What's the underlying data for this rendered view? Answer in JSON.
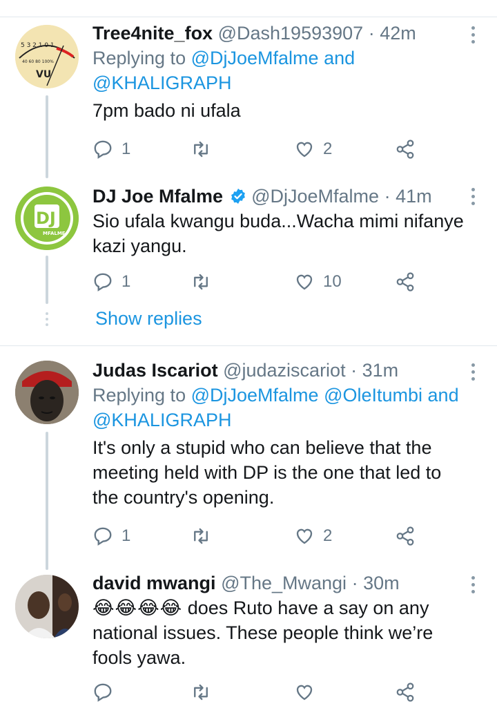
{
  "tweets": [
    {
      "name": "Tree4nite_fox",
      "handle": "@Dash19593907",
      "sep": "·",
      "time": "42m",
      "replying_prefix": "Replying to",
      "replying_mentions_line1": "@DjJoeMfalme",
      "replying_and": "and",
      "replying_mentions_line2": "@KHALIGRAPH",
      "text": "7pm bado ni ufala",
      "replies": "1",
      "retweets": "",
      "likes": "2"
    },
    {
      "name": "DJ Joe Mfalme",
      "handle": "@DjJoeMfalme",
      "sep": "·",
      "time": "41m",
      "text_line1": "Sio ufala kwangu buda...Wacha mimi nifanye",
      "text_line2": "kazi yangu.",
      "replies": "1",
      "retweets": "",
      "likes": "10",
      "avatar_text": "DJ",
      "avatar_subtext": "MFALME"
    },
    {
      "name": "Judas Iscariot",
      "handle": "@judaziscariot",
      "sep": "·",
      "time": "31m",
      "replying_prefix": "Replying to",
      "replying_mentions_line1": "@DjJoeMfalme @OleItumbi",
      "replying_and": "and",
      "replying_mentions_line2": "@KHALIGRAPH",
      "text_line1": "It's only a stupid who can believe that the",
      "text_line2": "meeting held with DP is the one that led to",
      "text_line3": "the country's opening.",
      "replies": "1",
      "retweets": "",
      "likes": "2"
    },
    {
      "name": "david mwangi",
      "handle": "@The_Mwangi",
      "sep": "·",
      "time": "30m",
      "emoji": "😂😂😂😂",
      "text_line1": " does Ruto have a say on any",
      "text_line2": "national issues. These people think we’re",
      "text_line3": "fools yawa.",
      "replies": "",
      "retweets": "",
      "likes": ""
    }
  ],
  "show_replies": "Show replies",
  "avatar1": {
    "gauge_scale": "5 3 2 1 0 1",
    "gauge_label": "VU",
    "gauge_small": "40 60 80 100%"
  },
  "colors": {
    "accent": "#1b95e0",
    "muted": "#657786",
    "dj_green": "#8dc63f"
  },
  "icons": [
    "reply-icon",
    "retweet-icon",
    "like-icon",
    "share-icon",
    "more-icon",
    "verified-icon"
  ]
}
